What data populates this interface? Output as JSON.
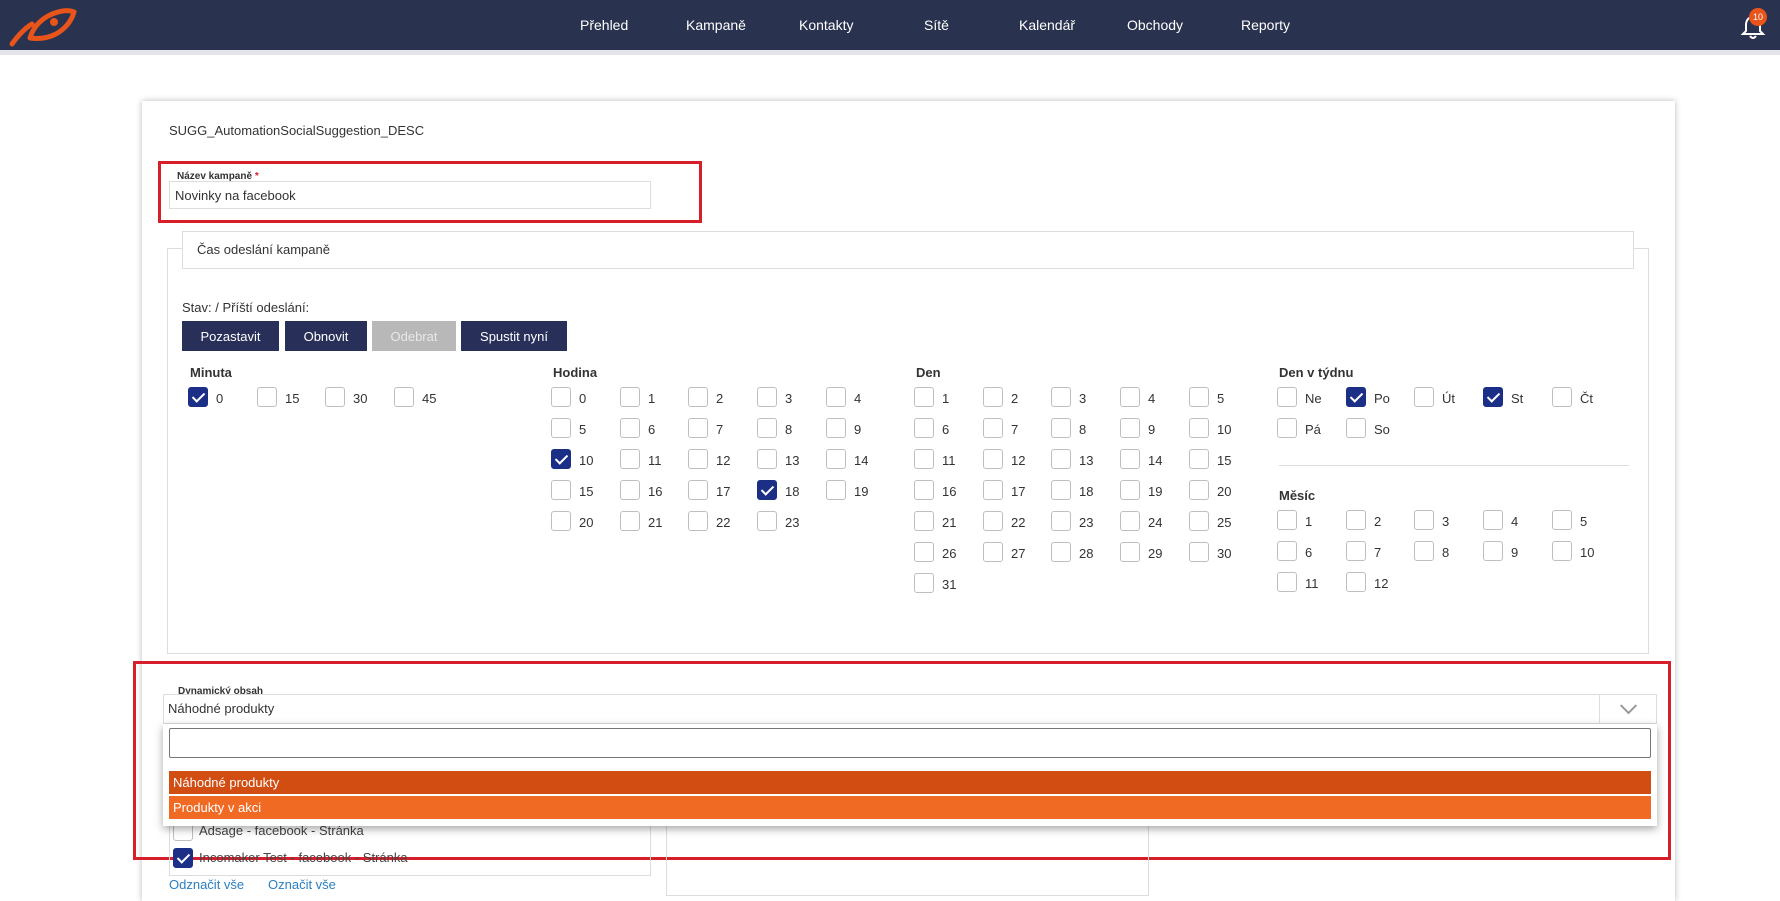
{
  "nav": {
    "items": [
      "Přehled",
      "Kampaně",
      "Kontakty",
      "Sítě",
      "Kalendář",
      "Obchody",
      "Reporty"
    ],
    "notification_count": "10",
    "colors": {
      "bar": "#29324e",
      "accent": "#e8541a"
    }
  },
  "form": {
    "description": "SUGG_AutomationSocialSuggestion_DESC",
    "name_label": "Název kampaně",
    "required_mark": "*",
    "name_value": "Novinky na facebook"
  },
  "schedule": {
    "legend": "Čas odeslání kampaně",
    "status": "Stav: / Příští odeslání:",
    "buttons": {
      "pause": "Pozastavit",
      "resume": "Obnovit",
      "remove": "Odebrat",
      "run_now": "Spustit nyní"
    },
    "minute": {
      "title": "Minuta",
      "options": [
        "0",
        "15",
        "30",
        "45"
      ],
      "checked": [
        "0"
      ]
    },
    "hour": {
      "title": "Hodina",
      "options": [
        "0",
        "1",
        "2",
        "3",
        "4",
        "5",
        "6",
        "7",
        "8",
        "9",
        "10",
        "11",
        "12",
        "13",
        "14",
        "15",
        "16",
        "17",
        "18",
        "19",
        "20",
        "21",
        "22",
        "23"
      ],
      "checked": [
        "10",
        "18"
      ]
    },
    "day": {
      "title": "Den",
      "options": [
        "1",
        "2",
        "3",
        "4",
        "5",
        "6",
        "7",
        "8",
        "9",
        "10",
        "11",
        "12",
        "13",
        "14",
        "15",
        "16",
        "17",
        "18",
        "19",
        "20",
        "21",
        "22",
        "23",
        "24",
        "25",
        "26",
        "27",
        "28",
        "29",
        "30",
        "31"
      ],
      "checked": []
    },
    "weekday": {
      "title": "Den v týdnu",
      "options": [
        "Ne",
        "Po",
        "Út",
        "St",
        "Čt",
        "Pá",
        "So"
      ],
      "checked": [
        "Po",
        "St"
      ]
    },
    "month": {
      "title": "Měsíc",
      "options": [
        "1",
        "2",
        "3",
        "4",
        "5",
        "6",
        "7",
        "8",
        "9",
        "10",
        "11",
        "12"
      ],
      "checked": []
    }
  },
  "dynamic": {
    "label": "Dynamický obsah",
    "selected": "Náhodné produkty",
    "search_value": "",
    "options": [
      {
        "label": "Náhodné produkty",
        "highlighted": true
      },
      {
        "label": "Produkty v akci",
        "highlighted": false
      }
    ],
    "option_colors": {
      "selected": "#d24d12",
      "other": "#f06a23"
    }
  },
  "profiles": {
    "items": [
      {
        "label": "Adsage - facebook - Stránka",
        "checked": false
      },
      {
        "label": "Incomaker Test - facebook - Stránka",
        "checked": true
      }
    ],
    "uncheck_all": "Odznačit vše",
    "check_all": "Označit vše"
  }
}
